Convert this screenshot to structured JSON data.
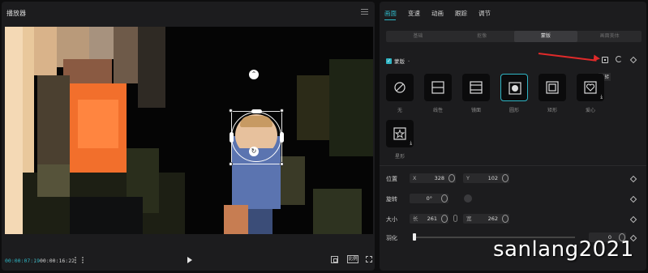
{
  "player": {
    "title": "播放器",
    "current_time": "00:00:07:19",
    "separator": "/",
    "total_time": "00:00:16:22",
    "ratio_label": "比例"
  },
  "panel": {
    "tabs": [
      {
        "label": "画面",
        "active": true
      },
      {
        "label": "变速"
      },
      {
        "label": "动画"
      },
      {
        "label": "跟踪"
      },
      {
        "label": "调节"
      }
    ],
    "subtabs": [
      {
        "label": "基础"
      },
      {
        "label": "抠像"
      },
      {
        "label": "蒙版",
        "active": true
      },
      {
        "label": "画面美体"
      }
    ],
    "mask_title": "蒙版",
    "invert_tooltip": "反转",
    "shapes": [
      {
        "label": "无",
        "icon": "none-icon"
      },
      {
        "label": "线性",
        "icon": "linear-mask-icon"
      },
      {
        "label": "镜面",
        "icon": "mirror-mask-icon"
      },
      {
        "label": "圆形",
        "icon": "circle-mask-icon",
        "active": true
      },
      {
        "label": "矩形",
        "icon": "rect-mask-icon"
      },
      {
        "label": "爱心",
        "icon": "heart-mask-icon"
      },
      {
        "label": "星形",
        "icon": "star-mask-icon"
      }
    ],
    "position": {
      "label": "位置",
      "x_prefix": "X",
      "x": "328",
      "y_prefix": "Y",
      "y": "102"
    },
    "rotation": {
      "label": "旋转",
      "value": "0°"
    },
    "size": {
      "label": "大小",
      "w_prefix": "长",
      "w": "261",
      "h_prefix": "宽",
      "h": "262"
    },
    "feather": {
      "label": "羽化",
      "value": "0",
      "level": 0
    }
  },
  "watermark": "sanlang2021",
  "colors": {
    "accent": "#2fb5c4",
    "arrow": "#e02a2a"
  }
}
